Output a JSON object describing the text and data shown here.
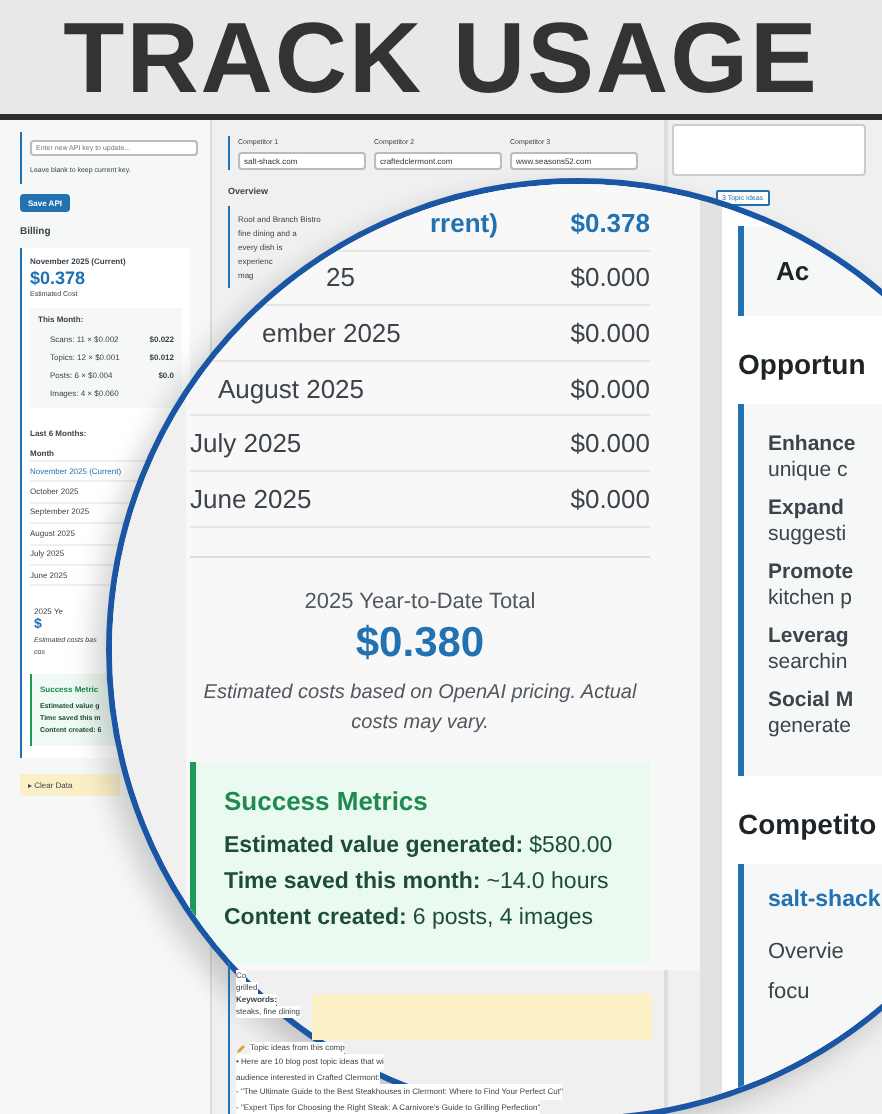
{
  "headline": "TRACK USAGE",
  "sidebar": {
    "api_key": {
      "placeholder": "Enter new API key to update..."
    },
    "api_hint": "Leave blank to keep current key.",
    "save_button": "Save API",
    "billing_heading": "Billing",
    "current": {
      "month": "November 2025 (Current)",
      "cost": "$0.378",
      "caption": "Estimated Cost"
    },
    "this_month": {
      "heading": "This Month:",
      "items": [
        {
          "label": "Scans: 11 × $0.002",
          "amount": "$0.022"
        },
        {
          "label": "Topics: 12 × $0.001",
          "amount": "$0.012"
        },
        {
          "label": "Posts: 6 × $0.004",
          "amount": "$0.0"
        },
        {
          "label": "Images: 4 × $0.060"
        }
      ]
    },
    "history": {
      "heading": "Last 6 Months:",
      "column": "Month",
      "months": [
        {
          "label": "November 2025 (Current)",
          "current": true
        },
        {
          "label": "October 2025",
          "current": false
        },
        {
          "label": "September 2025",
          "current": false
        },
        {
          "label": "August 2025",
          "current": false
        },
        {
          "label": "July 2025",
          "current": false
        },
        {
          "label": "June 2025",
          "current": false
        }
      ]
    },
    "ytd": {
      "label": "2025 Ye",
      "total": "$",
      "note": [
        "Estimated costs bas",
        "cos"
      ]
    },
    "metrics": {
      "title": "Success Metric",
      "lines": [
        "Estimated value g",
        "Time saved this m",
        "Content created: 6"
      ]
    },
    "clear_data": "▸ Clear Data"
  },
  "main": {
    "competitors": [
      {
        "label": "Competitor 1",
        "value": "salt-shack.com"
      },
      {
        "label": "Competitor 2",
        "value": "craftedclermont.com"
      },
      {
        "label": "Competitor 3",
        "value": "www.seasons52.com"
      }
    ],
    "overview_heading": "Overview",
    "overview_lines": [
      "Root and Branch Bistro",
      "fine dining and a",
      "every dish is",
      "experienc",
      "mag"
    ],
    "details": [
      "Co",
      "grilled",
      "Keywords:",
      "steaks, fine dining"
    ],
    "topics": {
      "heading": "Topic ideas from this comp",
      "lines": [
        "• Here are 10 blog post topic ideas that wi",
        "audience interested in Crafted Clermont:",
        "- \"The Ultimate Guide to the Best Steakhouses in Clermont: Where to Find Your Perfect Cut\"",
        "- \"Expert Tips for Choosing the Right Steak: A Carnivore's Guide to Grilling Perfection\""
      ]
    }
  },
  "right": {
    "generate_button": "3 Topic Ideas"
  },
  "magnifier": {
    "months": [
      {
        "label": "rrent)",
        "cost": "$0.378",
        "current": true
      },
      {
        "label": "25",
        "cost": "$0.000",
        "current": false
      },
      {
        "label": "ember 2025",
        "cost": "$0.000",
        "current": false
      },
      {
        "label": "August 2025",
        "cost": "$0.000",
        "current": false
      },
      {
        "label": "July 2025",
        "cost": "$0.000",
        "current": false
      },
      {
        "label": "June 2025",
        "cost": "$0.000",
        "current": false
      }
    ],
    "ytd_label": "2025 Year-to-Date Total",
    "ytd_total": "$0.380",
    "note": "Estimated costs based on OpenAI pricing. Actual costs may vary.",
    "metrics": {
      "title": "Success Metrics",
      "items": [
        {
          "label": "Estimated value generated:",
          "value": "$580.00"
        },
        {
          "label": "Time saved this month:",
          "value": "~14.0 hours"
        },
        {
          "label": "Content created:",
          "value": "6 posts, 4 images"
        }
      ]
    },
    "panel": {
      "top_label": "Ac",
      "opportunities_heading": "Opportun",
      "opportunities": [
        {
          "title": "Enhance",
          "text": "unique c"
        },
        {
          "title": "Expand",
          "text": "suggesti"
        },
        {
          "title": "Promote",
          "text": "kitchen p"
        },
        {
          "title": "Leverag",
          "text": "searchin"
        },
        {
          "title": "Social M",
          "text": "generate"
        }
      ],
      "competitors_heading": "Competito",
      "competitor": {
        "name": "salt-shack",
        "lines": [
          "Overvie",
          "focu"
        ]
      }
    }
  }
}
